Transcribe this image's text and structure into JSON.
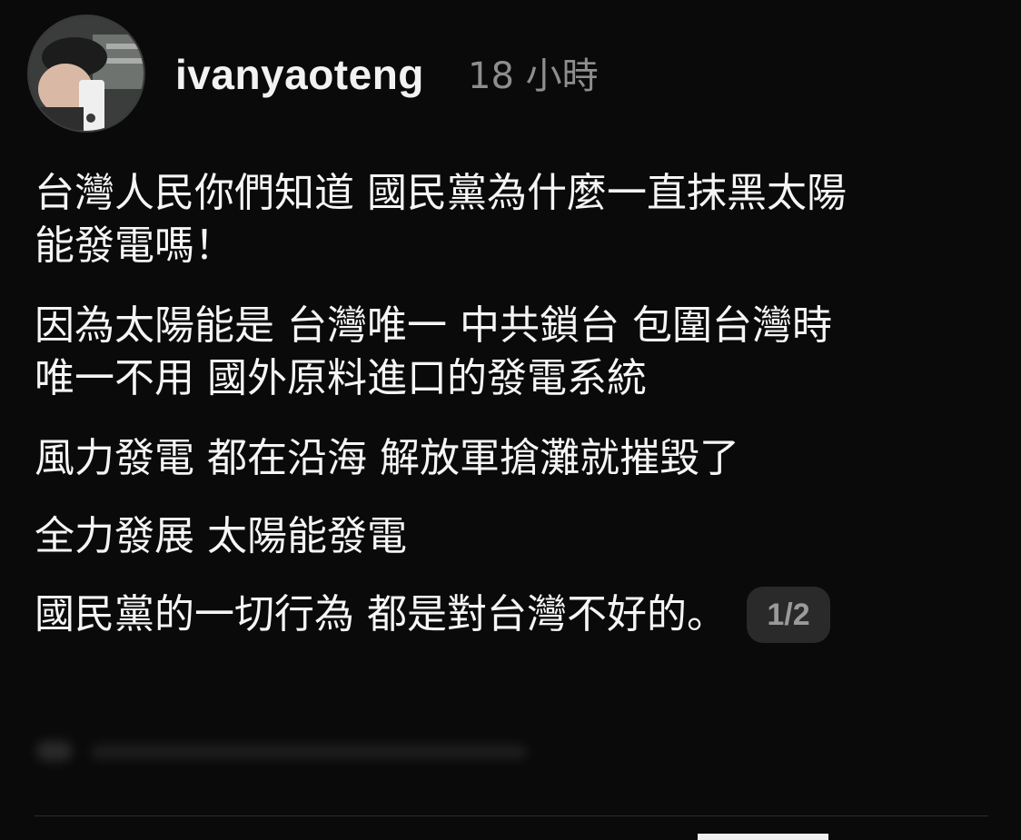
{
  "post": {
    "username": "ivanyaoteng",
    "timestamp": "18 小時",
    "avatar_icon": "profile-photo-avatar",
    "paragraphs": [
      [
        "台灣人民你們知道 國民黨為什麼一直抹黑太陽",
        "能發電嗎！"
      ],
      [
        "因為太陽能是 台灣唯一 中共鎖台 包圍台灣時",
        "唯一不用 國外原料進口的發電系統"
      ],
      [
        "風力發電 都在沿海 解放軍搶灘就摧毀了"
      ],
      [
        "全力發展 太陽能發電"
      ]
    ],
    "last_line": "國民黨的一切行為 都是對台灣不好的。",
    "page_indicator": "1/2"
  },
  "colors": {
    "background": "#0a0a0a",
    "text": "#f5f5f5",
    "muted": "#8e8e8e",
    "badge_bg": "#2a2a2a"
  }
}
